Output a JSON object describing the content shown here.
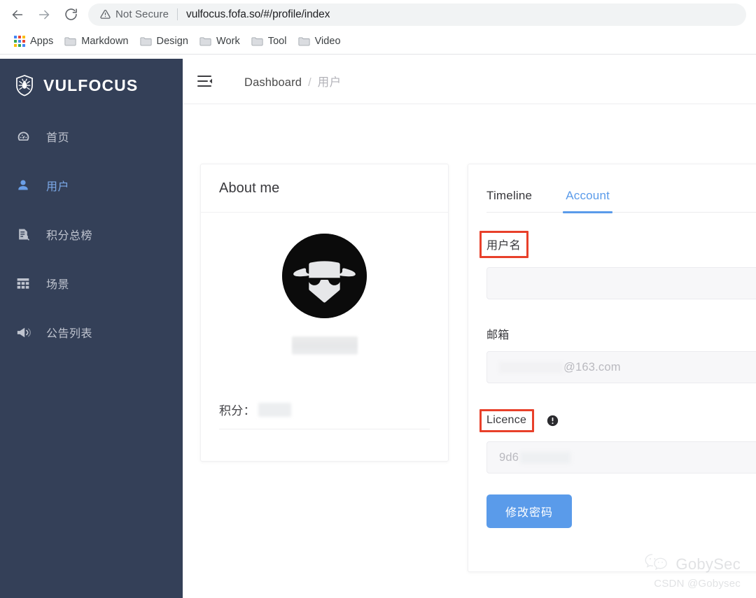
{
  "browser": {
    "back_icon": "arrow-left-icon",
    "forward_icon": "arrow-right-icon",
    "reload_icon": "reload-icon",
    "security_icon": "warning-triangle-icon",
    "security_label": "Not Secure",
    "url": "vulfocus.fofa.so/#/profile/index",
    "bookmarks": [
      {
        "label": "Apps",
        "icon": "apps-grid-icon"
      },
      {
        "label": "Markdown",
        "icon": "folder-icon"
      },
      {
        "label": "Design",
        "icon": "folder-icon"
      },
      {
        "label": "Work",
        "icon": "folder-icon"
      },
      {
        "label": "Tool",
        "icon": "folder-icon"
      },
      {
        "label": "Video",
        "icon": "folder-icon"
      }
    ]
  },
  "sidebar": {
    "brand": "VULFOCUS",
    "brand_icon": "shield-bug-icon",
    "background_color": "#344058",
    "active_color": "#7ba9e8",
    "items": [
      {
        "label": "首页",
        "icon": "dashboard-icon",
        "active": false
      },
      {
        "label": "用户",
        "icon": "user-icon",
        "active": true
      },
      {
        "label": "积分总榜",
        "icon": "ranking-list-icon",
        "active": false
      },
      {
        "label": "场景",
        "icon": "grid-scene-icon",
        "active": false
      },
      {
        "label": "公告列表",
        "icon": "megaphone-icon",
        "active": false
      }
    ]
  },
  "topbar": {
    "collapse_icon": "menu-collapse-icon",
    "breadcrumb": {
      "root": "Dashboard",
      "separator": "/",
      "current": "用户"
    }
  },
  "about_card": {
    "title": "About me",
    "avatar_icon": "incognito-avatar-icon",
    "username_value": "",
    "score_label": "积分：",
    "score_value": ""
  },
  "account_card": {
    "tabs": [
      {
        "label": "Timeline",
        "active": false
      },
      {
        "label": "Account",
        "active": true
      }
    ],
    "active_tab_color": "#5a9bea",
    "annotation_color": "#e8402a",
    "fields": [
      {
        "label": "用户名",
        "highlighted": true,
        "value": "",
        "disabled": true
      },
      {
        "label": "邮箱",
        "highlighted": false,
        "value": "@163.com",
        "disabled": true
      },
      {
        "label": "Licence",
        "highlighted": true,
        "info_icon": "exclamation-circle-icon",
        "value_prefix": "9d6",
        "value_suffix": "1269",
        "disabled": true
      }
    ],
    "submit_label": "修改密码",
    "submit_color": "#5a9bea"
  },
  "watermark": {
    "icon": "wechat-icon",
    "brand": "GobySec",
    "subtitle": "CSDN @Gobysec"
  }
}
